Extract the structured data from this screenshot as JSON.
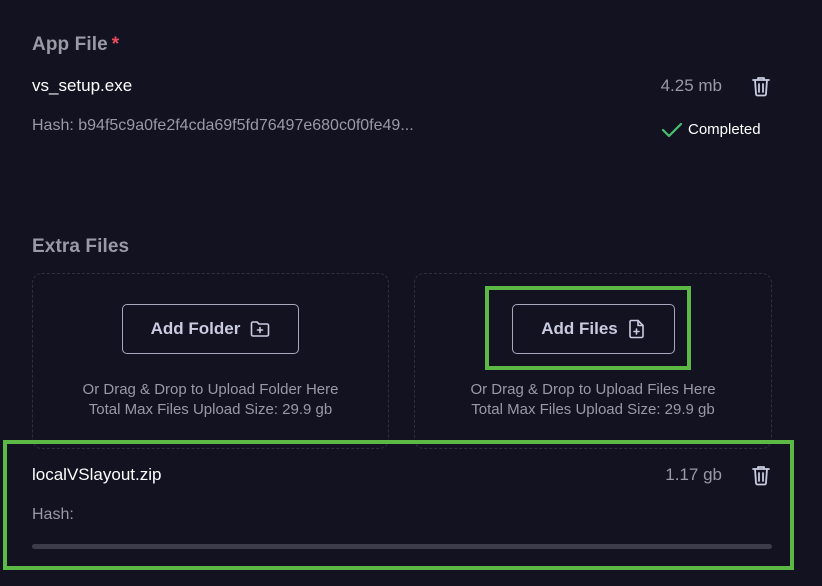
{
  "app_file": {
    "title": "App File",
    "required_marker": "*",
    "file_name": "vs_setup.exe",
    "file_size": "4.25 mb",
    "hash_label": "Hash:",
    "hash_value": "b94f5c9a0fe2f4cda69f5fd76497e680c0f0fe49...",
    "status": "Completed",
    "status_color": "#4cbf6e"
  },
  "extra_files": {
    "title": "Extra Files",
    "folder_zone": {
      "button_label": "Add Folder",
      "button_icon": "folder-plus-icon",
      "hint_line1": "Or Drag & Drop to Upload Folder Here",
      "hint_line2": "Total Max Files Upload Size: 29.9 gb"
    },
    "files_zone": {
      "button_label": "Add Files",
      "button_icon": "file-plus-icon",
      "hint_line1": "Or Drag & Drop to Upload Files Here",
      "hint_line2": "Total Max Files Upload Size: 29.9 gb"
    },
    "uploading_file": {
      "file_name": "localVSlayout.zip",
      "file_size": "1.17 gb",
      "hash_label": "Hash:",
      "hash_value": "",
      "progress": 0
    }
  },
  "colors": {
    "background": "#121220",
    "accent_highlight": "#5db946",
    "required": "#ef4b5d",
    "muted_text": "#9a9aa6"
  }
}
